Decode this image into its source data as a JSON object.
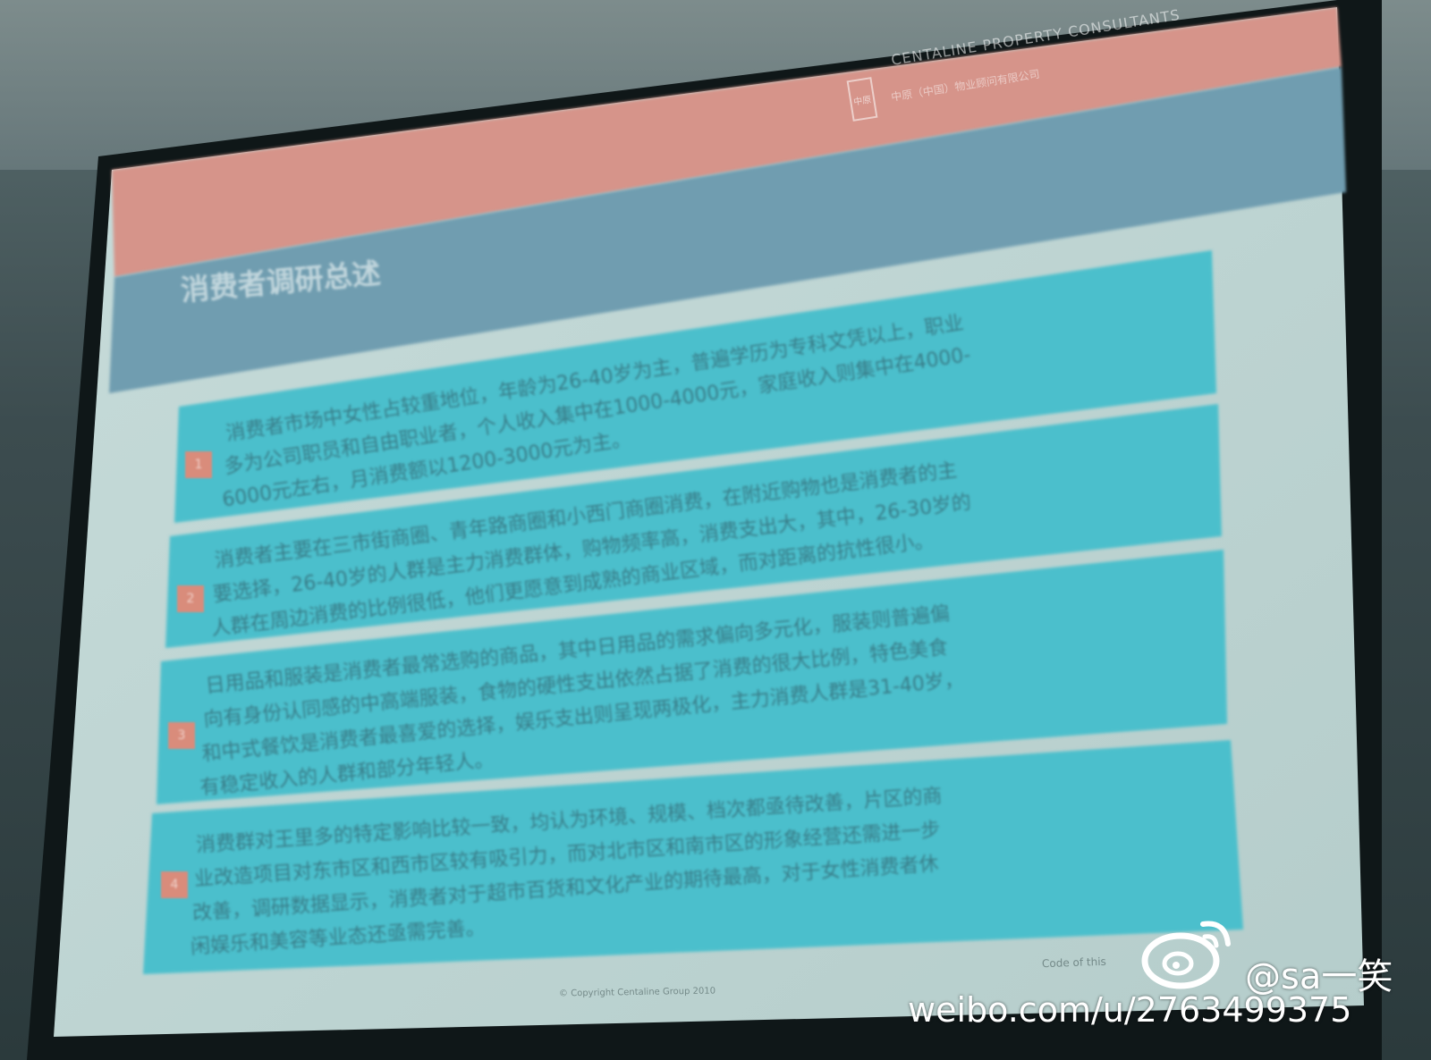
{
  "brand": {
    "name_en": "CENTALINE PROPERTY CONSULTANTS",
    "name_cn": "中原（中国）物业顾问有限公司",
    "logo_text": "中原"
  },
  "slide": {
    "title": "消费者调研总述",
    "items": [
      {
        "number": "1",
        "lines": [
          "消费者市场中女性占较重地位，年龄为26-40岁为主，普遍学历为专科文凭以上，职业",
          "多为公司职员和自由职业者，个人收入集中在1000-4000元，家庭收入则集中在4000-",
          "6000元左右，月消费额以1200-3000元为主。"
        ]
      },
      {
        "number": "2",
        "lines": [
          "消费者主要在三市街商圈、青年路商圈和小西门商圈消费，在附近购物也是消费者的主",
          "要选择，26-40岁的人群是主力消费群体，购物频率高，消费支出大，其中，26-30岁的",
          "人群在周边消费的比例很低，他们更愿意到成熟的商业区域，而对距离的抗性很小。"
        ]
      },
      {
        "number": "3",
        "lines": [
          "日用品和服装是消费者最常选购的商品，其中日用品的需求偏向多元化，服装则普遍偏",
          "向有身份认同感的中高端服装，食物的硬性支出依然占据了消费的很大比例，特色美食",
          "和中式餐饮是消费者最喜爱的选择，娱乐支出则呈现两极化，主力消费人群是31-40岁，",
          "有稳定收入的人群和部分年轻人。"
        ]
      },
      {
        "number": "4",
        "lines": [
          "消费群对王里多的特定影响比较一致，均认为环境、规模、档次都亟待改善，片区的商",
          "业改造项目对东市区和西市区较有吸引力，而对北市区和南市区的形象经营还需进一步",
          "改善，调研数据显示，消费者对于超市百货和文化产业的期待最高，对于女性消费者休",
          "闲娱乐和美容等业态还亟需完善。"
        ]
      }
    ],
    "footer_copyright": "© Copyright Centaline Group 2010",
    "footer_right": "Code of this"
  },
  "watermark": {
    "handle": "@sa一笑",
    "url": "weibo.com/u/2763499375",
    "icon": "weibo-icon"
  },
  "colors": {
    "salmon_band": "#d6948a",
    "slate_band": "#6f9db0",
    "cyan_box": "#4cbfcc",
    "badge": "#d98c7b"
  }
}
